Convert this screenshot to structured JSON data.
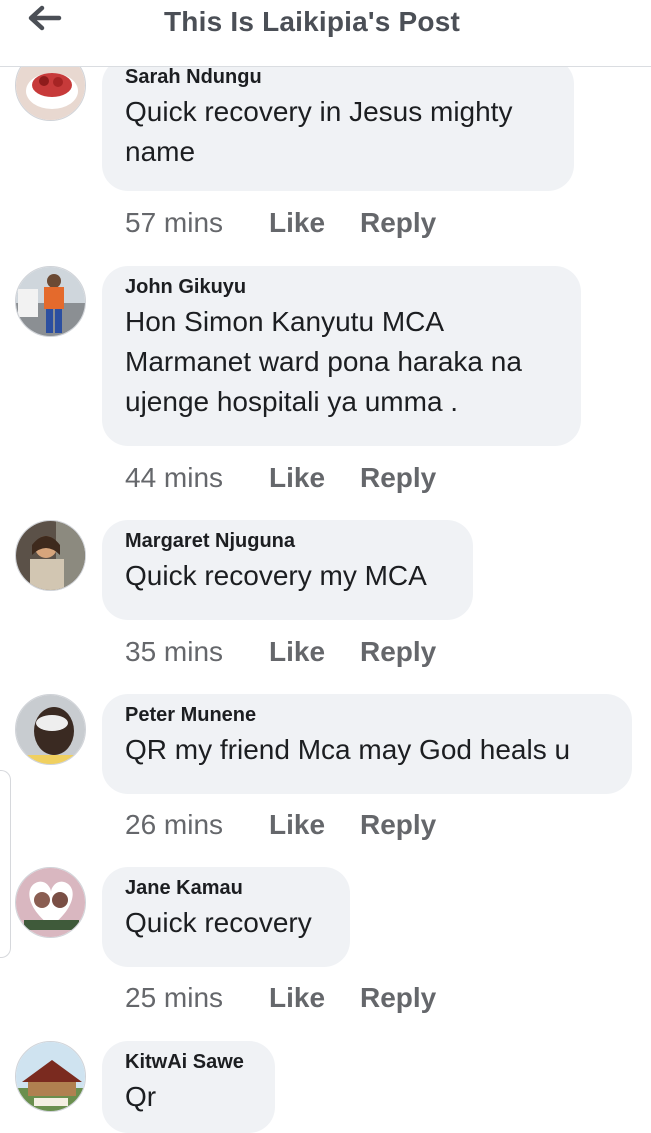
{
  "header": {
    "title": "This Is Laikipia's Post",
    "back_icon": "arrow-left-icon"
  },
  "actions": {
    "like_label": "Like",
    "reply_label": "Reply"
  },
  "comments": [
    {
      "author": "Sarah Ndungu",
      "text": "Quick recovery in Jesus mighty name",
      "time": "57 mins"
    },
    {
      "author": "John Gikuyu",
      "text": "Hon Simon Kanyutu MCA Marmanet ward pona haraka na ujenge hospitali ya umma .",
      "time": "44 mins"
    },
    {
      "author": "Margaret Njuguna",
      "text": "Quick recovery my MCA",
      "time": "35 mins"
    },
    {
      "author": "Peter Munene",
      "text": "QR my friend Mca may God heals u",
      "time": "26 mins"
    },
    {
      "author": "Jane Kamau",
      "text": "Quick recovery",
      "time": "25 mins"
    },
    {
      "author": "KitwAi Sawe",
      "text": "Qr",
      "time": ""
    }
  ],
  "colors": {
    "bubble": "#f0f2f5",
    "meta": "#65676b",
    "title": "#4b4f56"
  }
}
